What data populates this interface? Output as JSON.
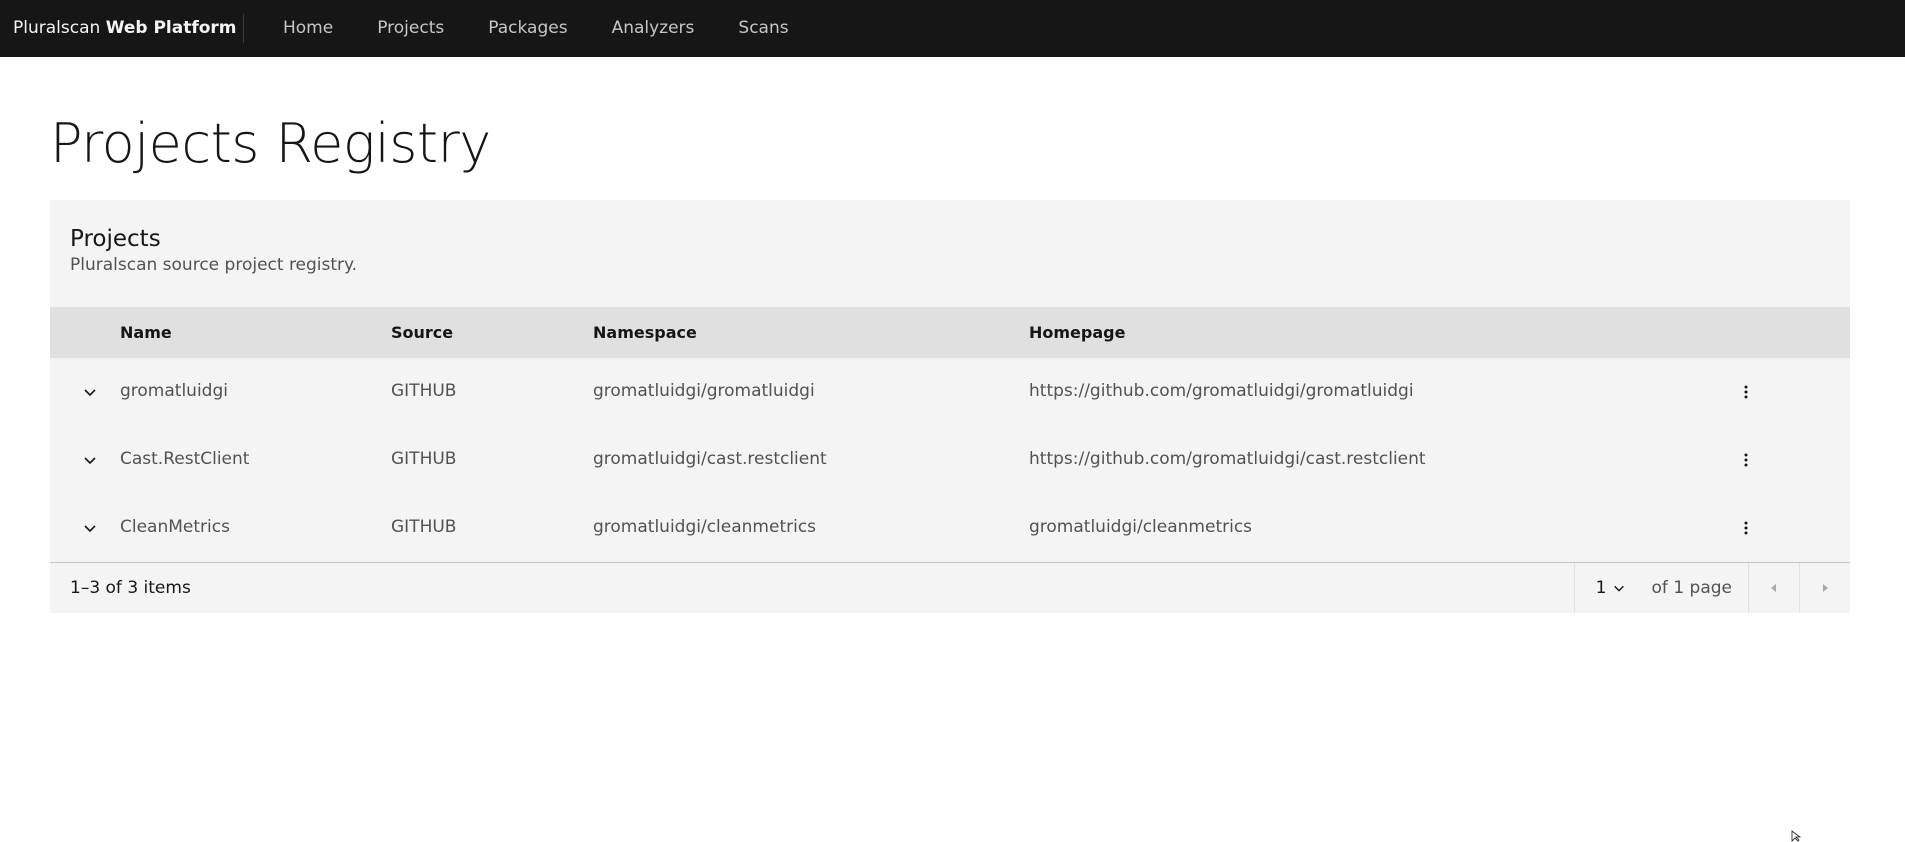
{
  "header": {
    "brand_prefix": "Pluralscan",
    "brand_bold": "Web Platform",
    "nav": [
      "Home",
      "Projects",
      "Packages",
      "Analyzers",
      "Scans"
    ]
  },
  "page": {
    "title": "Projects Registry"
  },
  "table": {
    "title": "Projects",
    "description": "Pluralscan source project registry.",
    "columns": {
      "name": "Name",
      "source": "Source",
      "namespace": "Namespace",
      "homepage": "Homepage"
    },
    "rows": [
      {
        "name": "gromatluidgi",
        "source": "GITHUB",
        "namespace": "gromatluidgi/gromatluidgi",
        "homepage": "https://github.com/gromatluidgi/gromatluidgi"
      },
      {
        "name": "Cast.RestClient",
        "source": "GITHUB",
        "namespace": "gromatluidgi/cast.restclient",
        "homepage": "https://github.com/gromatluidgi/cast.restclient"
      },
      {
        "name": "CleanMetrics",
        "source": "GITHUB",
        "namespace": "gromatluidgi/cleanmetrics",
        "homepage": "gromatluidgi/cleanmetrics"
      }
    ]
  },
  "pagination": {
    "items_text": "1–3 of 3 items",
    "page_value": "1",
    "of_pages_text": "of 1 page"
  },
  "icons": {
    "expand": "chevron-down-icon",
    "overflow": "overflow-menu-vertical-icon",
    "prev": "caret-left-icon",
    "next": "caret-right-icon"
  }
}
